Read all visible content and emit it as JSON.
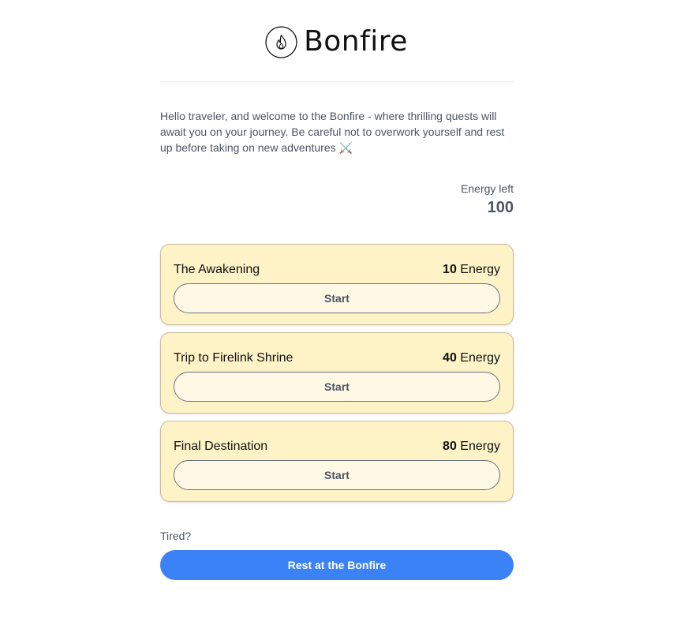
{
  "header": {
    "logo_icon": "flame-in-circle-icon",
    "brand": "Bonfire"
  },
  "intro": {
    "text": "Hello traveler, and welcome to the Bonfire - where thrilling quests will await you on your journey. Be careful not to overwork yourself and rest up before taking on new adventures ⚔️"
  },
  "energy": {
    "label": "Energy left",
    "value": "100"
  },
  "quests": [
    {
      "title": "The Awakening",
      "cost": "10",
      "unit": "Energy",
      "button": "Start"
    },
    {
      "title": "Trip to Firelink Shrine",
      "cost": "40",
      "unit": "Energy",
      "button": "Start"
    },
    {
      "title": "Final Destination",
      "cost": "80",
      "unit": "Energy",
      "button": "Start"
    }
  ],
  "rest": {
    "prompt": "Tired?",
    "button": "Rest at the Bonfire"
  },
  "colors": {
    "card_bg": "#fef3c7",
    "accent_blue": "#3b82f6",
    "muted_text": "#4b5563"
  }
}
